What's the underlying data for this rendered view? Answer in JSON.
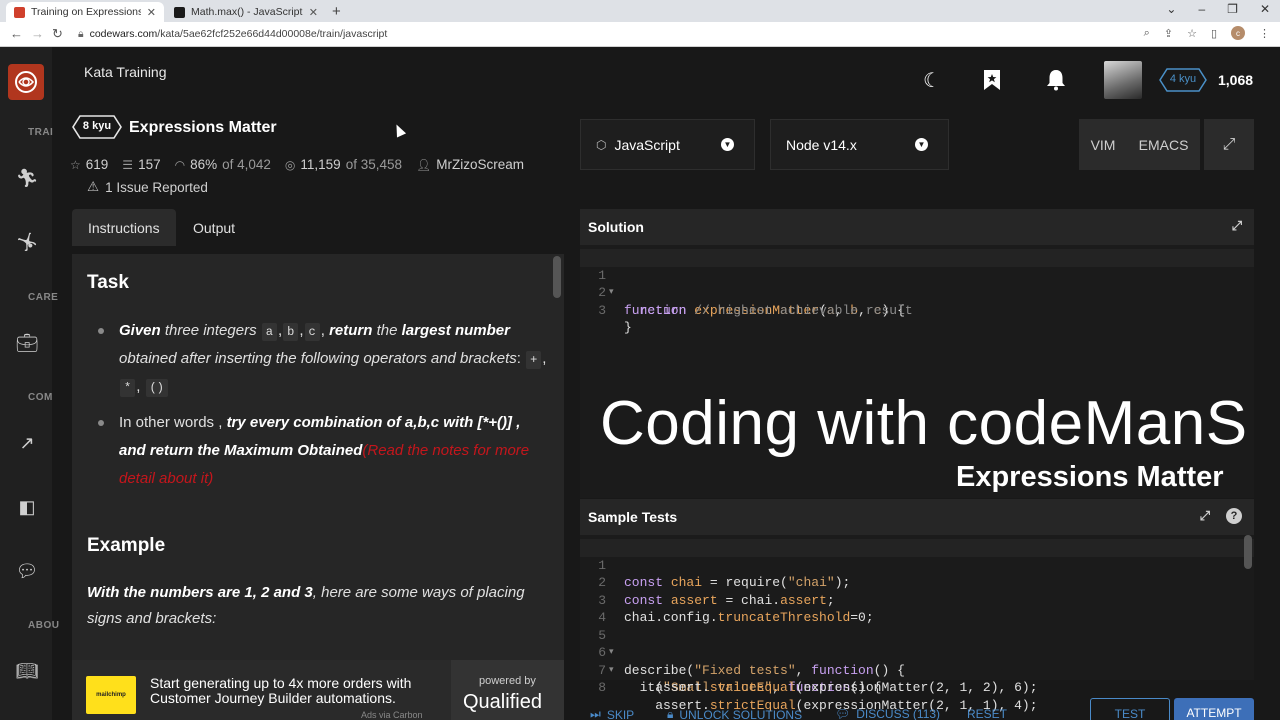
{
  "browser": {
    "tabs": [
      {
        "title": "Training on Expressions Matter |",
        "favicon_color": "#d0402c",
        "active": true
      },
      {
        "title": "Math.max() - JavaScript | MDN",
        "favicon_color": "#1a1a1a",
        "active": false
      }
    ],
    "url_host": "codewars.com",
    "url_path": "/kata/5ae62fcf252e66d44d00008e/train/javascript"
  },
  "sidebar": {
    "labels": [
      "TRAI",
      "CARE",
      "COM",
      "ABOU"
    ]
  },
  "header": {
    "title": "Kata Training",
    "rank": "4 kyu",
    "honor": "1,068"
  },
  "kata": {
    "kyu": "8 kyu",
    "name": "Expressions Matter",
    "stats": {
      "stars": "619",
      "collections": "157",
      "satisfaction": "86%",
      "satisfaction_of": "of 4,042",
      "completed": "11,159",
      "completed_of": "of 35,458",
      "author": "MrZizoScream"
    },
    "issues": "1 Issue Reported"
  },
  "instructions": {
    "tabs": [
      "Instructions",
      "Output"
    ],
    "task_heading": "Task",
    "bullet1": {
      "given": "Given",
      "three_integers": "three integers",
      "vars": [
        "a",
        "b",
        "c"
      ],
      "return": "return",
      "the": "the",
      "largest_number": "largest number",
      "rest": "obtained after inserting the following operators and brackets",
      "ops": [
        "+",
        "*",
        "()"
      ]
    },
    "bullet2": {
      "lead": "In other words ,",
      "emph1": "try every combination of a,b,c with [*+()] ,",
      "emph2": "and return the Maximum Obtained",
      "red_note": "(Read the notes for more detail about it)"
    },
    "example_heading": "Example",
    "example_bold": "With the numbers are 1, 2 and 3",
    "example_rest": ", here are some ways of placing signs and brackets:"
  },
  "ad": {
    "text": "Start generating up to 4x more orders with Customer Journey Builder automations.",
    "logo_text": "mailchimp",
    "via": "Ads via Carbon",
    "powered": "powered by",
    "brand": "Qualified"
  },
  "editor_controls": {
    "language": "JavaScript",
    "runtime": "Node v14.x",
    "mode_vim": "VIM",
    "mode_emacs": "EMACS"
  },
  "solution": {
    "title": "Solution",
    "lines": [
      {
        "n": "1",
        "fold": true,
        "code": "function expressionMatter(a, b, c) {"
      },
      {
        "n": "2",
        "fold": false,
        "code": "  return // highest achievable result"
      },
      {
        "n": "3",
        "fold": false,
        "code": "}"
      }
    ]
  },
  "overlay": {
    "title": "Coding with codeManS",
    "subtitle": "Expressions Matter"
  },
  "tests": {
    "title": "Sample Tests",
    "help": "?",
    "lines": [
      {
        "n": "1",
        "fold": false,
        "code": "const chai = require(\"chai\");"
      },
      {
        "n": "2",
        "fold": false,
        "code": "const assert = chai.assert;"
      },
      {
        "n": "3",
        "fold": false,
        "code": "chai.config.truncateThreshold=0;"
      },
      {
        "n": "4",
        "fold": false,
        "code": ""
      },
      {
        "n": "5",
        "fold": true,
        "code": "describe(\"Fixed tests\", function() {"
      },
      {
        "n": "6",
        "fold": true,
        "code": "  it(\"Small values\", function() {"
      },
      {
        "n": "7",
        "fold": false,
        "code": "    assert.strictEqual(expressionMatter(2, 1, 2), 6);"
      },
      {
        "n": "8",
        "fold": false,
        "code": "    assert.strictEqual(expressionMatter(2, 1, 1), 4);"
      }
    ]
  },
  "actions": {
    "skip": "SKIP",
    "unlock": "UNLOCK SOLUTIONS",
    "discuss": "DISCUSS (113)",
    "reset": "RESET",
    "test": "TEST",
    "attempt": "ATTEMPT"
  }
}
